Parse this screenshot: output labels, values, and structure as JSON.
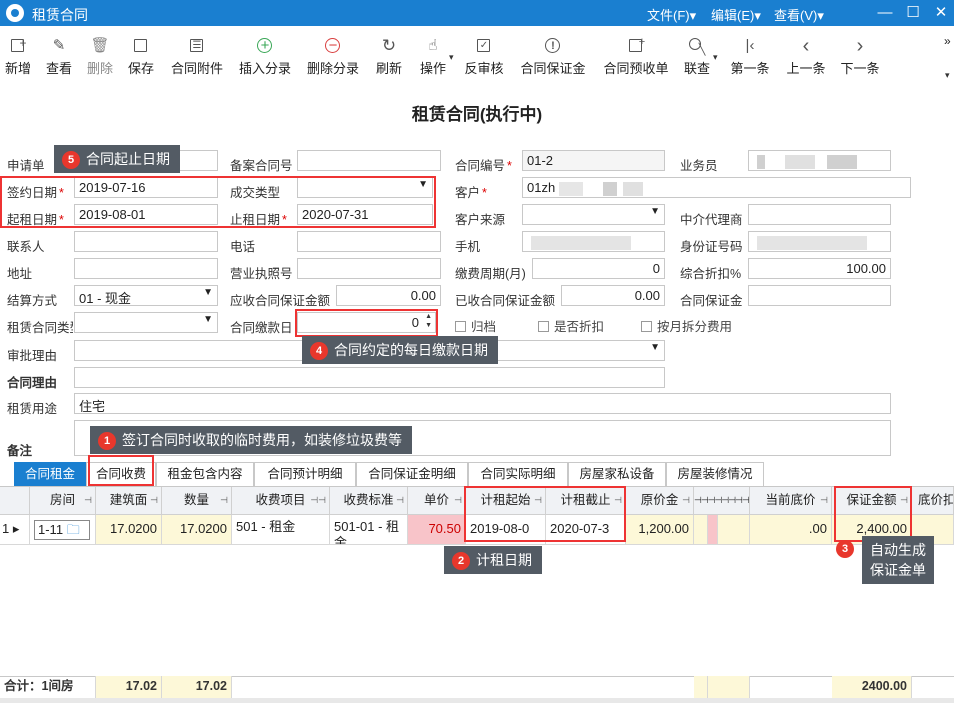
{
  "window": {
    "title": "租赁合同",
    "menus": [
      "文件(F)▾",
      "编辑(E)▾",
      "查看(V)▾"
    ],
    "overflow": "»"
  },
  "toolbar": [
    {
      "label": "新增",
      "icon": "add-doc-icon",
      "glyph": "+"
    },
    {
      "label": "查看",
      "icon": "edit-icon",
      "glyph": "✎"
    },
    {
      "label": "删除",
      "icon": "trash-icon",
      "glyph": "🗑"
    },
    {
      "label": "保存",
      "icon": "save-icon",
      "glyph": "▣"
    },
    {
      "label": "合同附件",
      "icon": "attachment-icon",
      "glyph": "☰"
    },
    {
      "label": "插入分录",
      "icon": "insert-row-icon",
      "glyph": "+"
    },
    {
      "label": "删除分录",
      "icon": "delete-row-icon",
      "glyph": "−"
    },
    {
      "label": "刷新",
      "icon": "refresh-icon",
      "glyph": "↻"
    },
    {
      "label": "操作",
      "icon": "hand-icon",
      "glyph": "☝"
    },
    {
      "label": "反审核",
      "icon": "unaudit-icon",
      "glyph": "✓"
    },
    {
      "label": "合同保证金",
      "icon": "alert-circle-icon",
      "glyph": "!"
    },
    {
      "label": "合同预收单",
      "icon": "receipt-icon",
      "glyph": "+"
    },
    {
      "label": "联查",
      "icon": "search-icon",
      "glyph": "○"
    },
    {
      "label": "第一条",
      "icon": "first-record-icon",
      "glyph": "|‹"
    },
    {
      "label": "上一条",
      "icon": "prev-record-icon",
      "glyph": "‹"
    },
    {
      "label": "下一条",
      "icon": "next-record-icon",
      "glyph": "›"
    }
  ],
  "doc_title": "租赁合同(执行中)",
  "fields": {
    "application_no": {
      "label": "申请单",
      "value": ""
    },
    "record_no": {
      "label": "备案合同号",
      "value": ""
    },
    "contract_no": {
      "label": "合同编号",
      "value": "01-2"
    },
    "salesman": {
      "label": "业务员",
      "value": ""
    },
    "sign_date": {
      "label": "签约日期",
      "value": "2019-07-16"
    },
    "deal_type": {
      "label": "成交类型",
      "value": ""
    },
    "customer": {
      "label": "客户",
      "value": "01zh"
    },
    "start_date": {
      "label": "起租日期",
      "value": "2019-08-01"
    },
    "end_date": {
      "label": "止租日期",
      "value": "2020-07-31"
    },
    "customer_source": {
      "label": "客户来源",
      "value": ""
    },
    "agent": {
      "label": "中介代理商",
      "value": ""
    },
    "contact": {
      "label": "联系人",
      "value": ""
    },
    "phone": {
      "label": "电话",
      "value": ""
    },
    "mobile": {
      "label": "手机",
      "value": ""
    },
    "id_card": {
      "label": "身份证号码",
      "value": ""
    },
    "address": {
      "label": "地址",
      "value": ""
    },
    "license": {
      "label": "营业执照号",
      "value": ""
    },
    "pay_period": {
      "label": "缴费周期(月)",
      "value": "0"
    },
    "discount": {
      "label": "综合折扣%",
      "value": "100.00"
    },
    "settle_method": {
      "label": "结算方式",
      "value": "01 - 现金"
    },
    "deposit_due": {
      "label": "应收合同保证金额",
      "value": "0.00"
    },
    "deposit_received": {
      "label": "已收合同保证金额",
      "value": "0.00"
    },
    "contract_deposit": {
      "label": "合同保证金",
      "value": ""
    },
    "lease_type": {
      "label": "租赁合同类型",
      "value": ""
    },
    "pay_day": {
      "label": "合同缴款日",
      "value": "0"
    },
    "approval_reason": {
      "label": "审批理由",
      "value": ""
    },
    "contract_reason": {
      "label": "合同理由",
      "value": ""
    },
    "lease_use": {
      "label": "租赁用途",
      "value": "住宅"
    },
    "remark": {
      "label": "备注",
      "value": ""
    }
  },
  "checkboxes": {
    "archive": "归档",
    "discount_flag": "是否折扣",
    "split_by_month": "按月拆分费用"
  },
  "callouts": {
    "c1": "签订合同时收取的临时费用，如装修垃圾费等",
    "c2": "计租日期",
    "c3_line1": "自动生成",
    "c3_line2": "保证金单",
    "c4": "合同约定的每日缴款日期",
    "c5": "合同起止日期",
    "n1": "1",
    "n2": "2",
    "n3": "3",
    "n4": "4",
    "n5": "5"
  },
  "tabs": [
    "合同租金",
    "合同收费",
    "租金包含内容",
    "合同预计明细",
    "合同保证金明细",
    "合同实际明细",
    "房屋家私设备",
    "房屋装修情况"
  ],
  "grid": {
    "headers": {
      "room": "房间",
      "area": "建筑面",
      "qty": "数量",
      "item": "收费项目",
      "std": "收费标准",
      "price": "单价",
      "rent_start": "计租起始",
      "rent_end": "计租截止",
      "orig_price": "原价金",
      "floor_price": "当前底价",
      "deposit": "保证金额",
      "floor_adj": "底价扣"
    },
    "row": {
      "idx": "1",
      "room": "1-11",
      "area": "17.0200",
      "qty": "17.0200",
      "item": "501 - 租金",
      "std": "501-01 - 租金",
      "price": "70.50",
      "rent_start": "2019-08-0",
      "rent_end": "2020-07-3",
      "orig_price": "1,200.00",
      "floor_price": ".00",
      "deposit": "2,400.00"
    },
    "footer": {
      "label": "合计：1间房",
      "area": "17.02",
      "qty": "17.02",
      "deposit": "2400.00"
    }
  }
}
